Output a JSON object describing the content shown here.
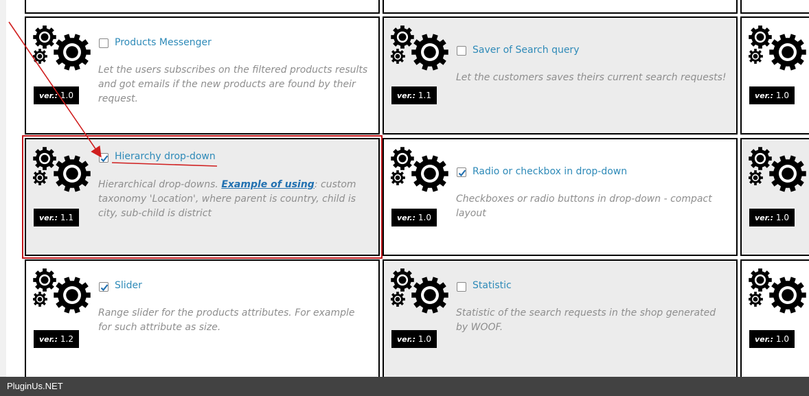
{
  "extensions": [
    {
      "title": "Products Messenger",
      "checked": false,
      "description": "Let the users subscribes on the filtered products results and got emails if the new products are found by their request.",
      "version": "1.0"
    },
    {
      "title": "Saver of Search query",
      "checked": false,
      "description": "Let the customers saves theirs current search requests!",
      "version": "1.1"
    },
    {
      "title": "",
      "checked": false,
      "description": "",
      "version": "1.0"
    },
    {
      "title": "Hierarchy drop-down",
      "checked": true,
      "description_prefix": "Hierarchical drop-downs. ",
      "link_text": "Example of using",
      "description_suffix": ": custom taxonomy 'Location', where parent is country, child is city, sub-child is district",
      "version": "1.1"
    },
    {
      "title": "Radio or checkbox in drop-down",
      "checked": true,
      "description": "Checkboxes or radio buttons in drop-down - compact layout",
      "version": "1.0"
    },
    {
      "title": "",
      "checked": false,
      "description": "",
      "version": "1.0"
    },
    {
      "title": "Slider",
      "checked": true,
      "description": "Range slider for the products attributes. For example for such attribute as size.",
      "version": "1.2"
    },
    {
      "title": "Statistic",
      "checked": false,
      "description": "Statistic of the search requests in the shop generated by WOOF.",
      "version": "1.0"
    },
    {
      "title": "",
      "checked": false,
      "description": "",
      "version": "1.0"
    }
  ],
  "version_label": "ver.:",
  "footer": {
    "text": "PluginUs.NET"
  },
  "colors": {
    "highlight": "#c0171b",
    "link": "#2e8ab8",
    "checkbox_check": "#2271b1"
  },
  "icons": {
    "extension": "gears-icon",
    "checkbox": "checkbox-icon",
    "annotation": "red-arrow-annotation"
  }
}
